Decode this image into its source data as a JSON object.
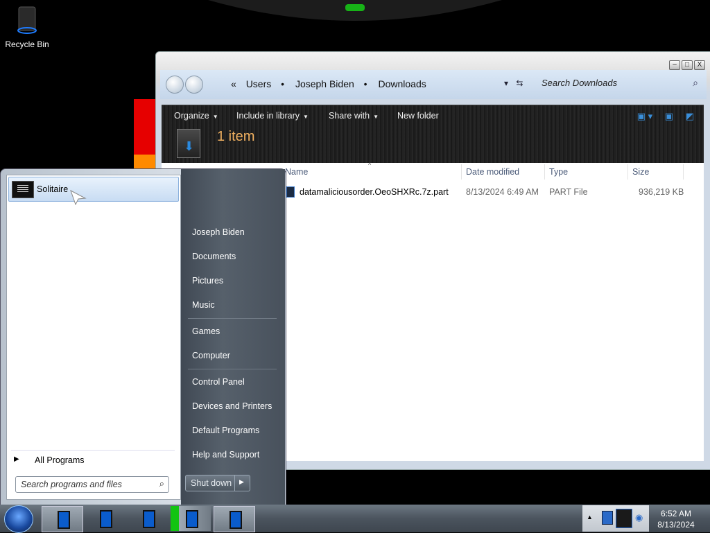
{
  "desktop": {
    "recycle_bin_label": "Recycle Bin"
  },
  "explorer": {
    "window_controls": {
      "minimize": "–",
      "maximize": "□",
      "close": "X"
    },
    "breadcrumb": [
      "Users",
      "Joseph Biden",
      "Downloads"
    ],
    "breadcrumb_prefix": "«",
    "search_placeholder": "Search Downloads",
    "toolbar": {
      "organize": "Organize",
      "include_in_library": "Include in library",
      "share_with": "Share with",
      "new_folder": "New folder"
    },
    "item_count": "1 item",
    "columns": {
      "name": "Name",
      "date_modified": "Date modified",
      "type": "Type",
      "size": "Size"
    },
    "files": [
      {
        "name": "datamaliciousorder.OeoSHXRc.7z.part",
        "date_modified": "8/13/2024 6:49 AM",
        "type": "PART File",
        "size": "936,219 KB"
      }
    ]
  },
  "start_menu": {
    "pinned_item": "Solitaire",
    "all_programs": "All Programs",
    "search_placeholder": "Search programs and files",
    "right_items": [
      "Joseph Biden",
      "Documents",
      "Pictures",
      "Music",
      "Games",
      "Computer",
      "Control Panel",
      "Devices and Printers",
      "Default Programs",
      "Help and Support"
    ],
    "shutdown_label": "Shut down"
  },
  "taskbar": {
    "clock_time": "6:52 AM",
    "clock_date": "8/13/2024"
  }
}
